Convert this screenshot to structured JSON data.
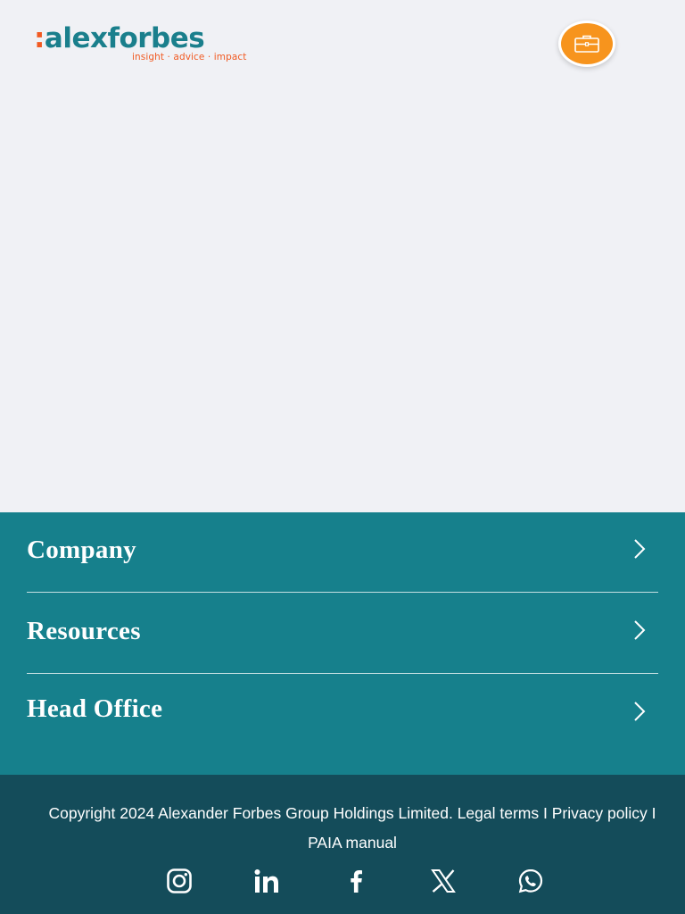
{
  "header": {
    "logo": {
      "colon": ":",
      "name": "alexforbes",
      "tagline": "insight · advice · impact"
    },
    "action_icon": "briefcase-icon",
    "action_color": "#f7941d"
  },
  "footer_menu": {
    "background": "#16808c",
    "items": [
      {
        "label": "Company",
        "icon": "chevron-right-icon"
      },
      {
        "label": "Resources",
        "icon": "chevron-right-icon"
      },
      {
        "label": "Head Office",
        "icon": "chevron-right-icon"
      }
    ]
  },
  "bottom_bar": {
    "background": "#144c5a",
    "copyright": "Copyright 2024 Alexander Forbes Group Holdings Limited.",
    "links": {
      "legal": "Legal terms",
      "privacy": "Privacy policy",
      "paia": "PAIA manual"
    },
    "separator": "I",
    "social": [
      "instagram-icon",
      "linkedin-icon",
      "facebook-icon",
      "x-icon",
      "whatsapp-icon"
    ]
  },
  "colors": {
    "brand_orange": "#f15a22",
    "brand_teal": "#1a7f8c",
    "page_bg": "#f0f1f5"
  }
}
